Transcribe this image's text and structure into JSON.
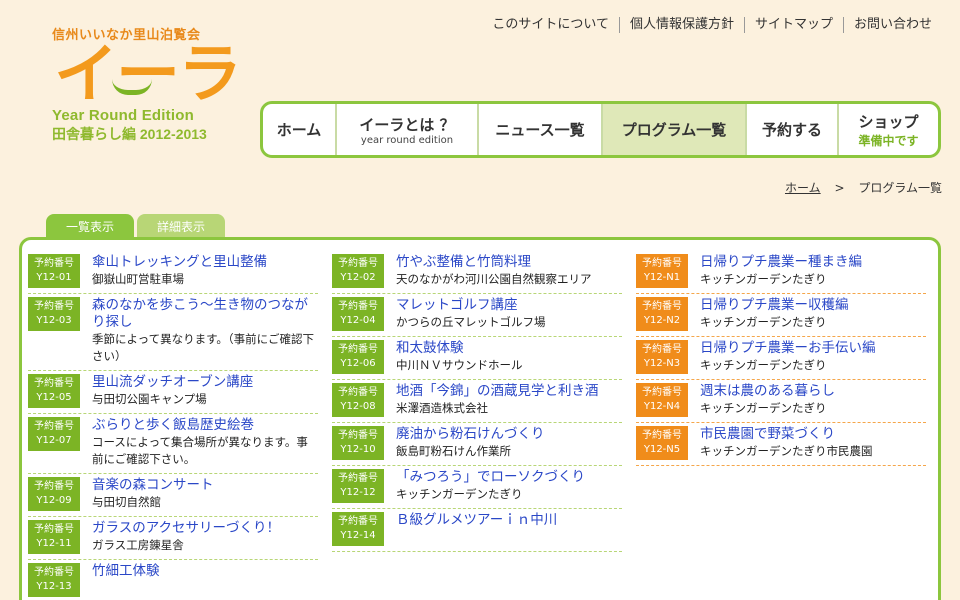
{
  "logo": {
    "tagline": "信州いいなか里山泊覧会",
    "main": "イーラ",
    "edition": "Year Round Edition",
    "sub": "田舎暮らし編 2012-2013"
  },
  "toplinks": [
    "このサイトについて",
    "個人情報保護方針",
    "サイトマップ",
    "お問い合わせ"
  ],
  "gnav": {
    "home": "ホーム",
    "about": "イーラとは ？",
    "about_sub": "year round edition",
    "news": "ニュース一覧",
    "programs": "プログラム一覧",
    "reserve": "予約する",
    "shop": "ショップ",
    "shop_sub": "準備中です"
  },
  "breadcrumb": {
    "home": "ホーム",
    "sep": ">",
    "current": "プログラム一覧"
  },
  "tabs": {
    "list": "一覧表示",
    "detail": "詳細表示"
  },
  "badge_label": "予約番号",
  "columns": [
    [
      {
        "code": "Y12-01",
        "title": "傘山トレッキングと里山整備",
        "place": "御嶽山町営駐車場"
      },
      {
        "code": "Y12-03",
        "title": "森のなかを歩こう〜生き物のつながり探し",
        "place": "季節によって異なります。（事前にご確認下さい）"
      },
      {
        "code": "Y12-05",
        "title": "里山流ダッチオーブン講座",
        "place": "与田切公園キャンプ場"
      },
      {
        "code": "Y12-07",
        "title": "ぶらりと歩く飯島歴史絵巻",
        "place": "コースによって集合場所が異なります。事前にご確認下さい。"
      },
      {
        "code": "Y12-09",
        "title": "音楽の森コンサート",
        "place": "与田切自然館"
      },
      {
        "code": "Y12-11",
        "title": "ガラスのアクセサリーづくり！",
        "place": "ガラス工房錬星舎"
      },
      {
        "code": "Y12-13",
        "title": "竹細工体験",
        "place": ""
      }
    ],
    [
      {
        "code": "Y12-02",
        "title": "竹やぶ整備と竹筒料理",
        "place": "天のなかがわ河川公園自然観察エリア"
      },
      {
        "code": "Y12-04",
        "title": "マレットゴルフ講座",
        "place": "かつらの丘マレットゴルフ場"
      },
      {
        "code": "Y12-06",
        "title": "和太鼓体験",
        "place": "中川ＮＶサウンドホール"
      },
      {
        "code": "Y12-08",
        "title": "地酒「今錦」の酒蔵見学と利き酒",
        "place": "米澤酒造株式会社"
      },
      {
        "code": "Y12-10",
        "title": "廃油から粉石けんづくり",
        "place": "飯島町粉石けん作業所"
      },
      {
        "code": "Y12-12",
        "title": "「みつろう」でローソクづくり",
        "place": "キッチンガーデンたぎり"
      },
      {
        "code": "Y12-14",
        "title": "Ｂ級グルメツアーｉｎ中川",
        "place": ""
      }
    ],
    [
      {
        "code": "Y12-N1",
        "title": "日帰りプチ農業ー種まき編",
        "place": "キッチンガーデンたぎり"
      },
      {
        "code": "Y12-N2",
        "title": "日帰りプチ農業ー収穫編",
        "place": "キッチンガーデンたぎり"
      },
      {
        "code": "Y12-N3",
        "title": "日帰りプチ農業ーお手伝い編",
        "place": "キッチンガーデンたぎり"
      },
      {
        "code": "Y12-N4",
        "title": "週末は農のある暮らし",
        "place": "キッチンガーデンたぎり"
      },
      {
        "code": "Y12-N5",
        "title": "市民農園で野菜づくり",
        "place": "キッチンガーデンたぎり市民農園"
      }
    ]
  ]
}
